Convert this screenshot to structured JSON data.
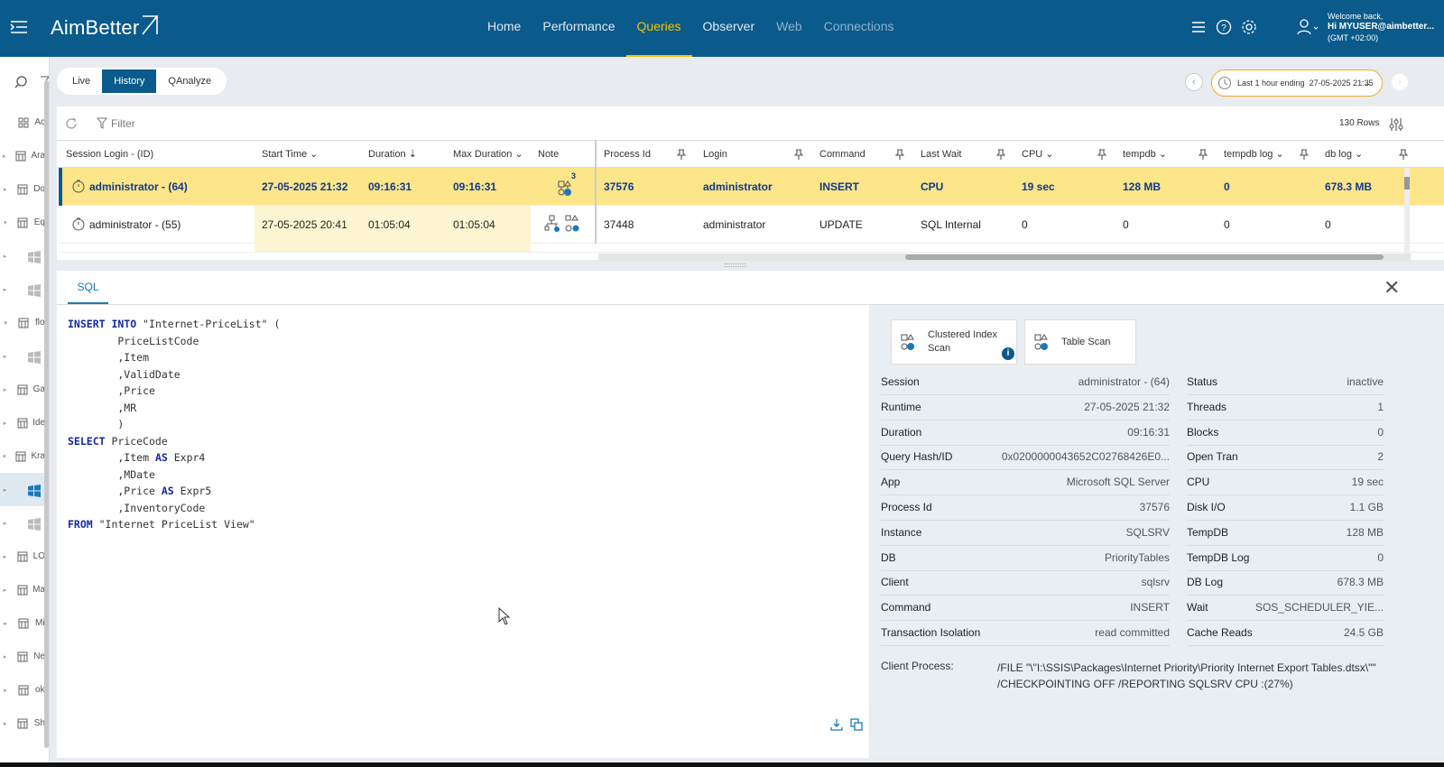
{
  "header": {
    "logo": "AimBetter",
    "nav": [
      {
        "label": "Home",
        "state": "normal"
      },
      {
        "label": "Performance",
        "state": "normal"
      },
      {
        "label": "Queries",
        "state": "active"
      },
      {
        "label": "Observer",
        "state": "normal"
      },
      {
        "label": "Web",
        "state": "dim"
      },
      {
        "label": "Connections",
        "state": "dim"
      }
    ],
    "welcome": "Welcome back,",
    "user": "Hi MYUSER@aimbetter...",
    "tz": "(GMT +02:00)",
    "icons": [
      "list-icon",
      "help-icon",
      "gear-icon",
      "user-icon"
    ]
  },
  "sidebar": {
    "rows": [
      {
        "label": "Ac",
        "icon": "grid-icon",
        "tri": ""
      },
      {
        "label": "Ara",
        "icon": "table-icon",
        "tri": "▸"
      },
      {
        "label": "Do",
        "icon": "table-icon",
        "tri": "▸"
      },
      {
        "label": "Eq",
        "icon": "table-icon",
        "tri": "▾"
      },
      {
        "label": "",
        "icon": "windows-icon",
        "tri": "▸"
      },
      {
        "label": "",
        "icon": "windows-icon",
        "tri": "▸"
      },
      {
        "label": "flo",
        "icon": "table-icon",
        "tri": "▾"
      },
      {
        "label": "",
        "icon": "windows-icon",
        "tri": "▸"
      },
      {
        "label": "Ga",
        "icon": "table-icon",
        "tri": "▸"
      },
      {
        "label": "Ide",
        "icon": "table-icon",
        "tri": "▸"
      },
      {
        "label": "Kra",
        "icon": "table-icon",
        "tri": "▾"
      },
      {
        "label": "",
        "icon": "windows-icon",
        "tri": "▸",
        "selected": true
      },
      {
        "label": "",
        "icon": "windows-icon",
        "tri": "▸"
      },
      {
        "label": "LO",
        "icon": "table-icon",
        "tri": "▸"
      },
      {
        "label": "Ma",
        "icon": "table-icon",
        "tri": "▸"
      },
      {
        "label": "Mi",
        "icon": "table-icon",
        "tri": "▸"
      },
      {
        "label": "Ne",
        "icon": "table-icon",
        "tri": "▸"
      },
      {
        "label": "ok",
        "icon": "table-icon",
        "tri": "▸"
      },
      {
        "label": "Sh",
        "icon": "table-icon",
        "tri": "▸"
      }
    ]
  },
  "toolbar": {
    "tabs": [
      {
        "label": "Live"
      },
      {
        "label": "History",
        "active": true
      },
      {
        "label": "QAnalyze"
      }
    ],
    "time_prefix": "Last 1 hour ending",
    "time_value": "27-05-2025 21:35"
  },
  "grid": {
    "filter_placeholder": "Filter",
    "rows_count": "130 Rows",
    "columns": [
      "Session Login - (ID)",
      "Start Time",
      "Duration",
      "Max Duration",
      "Note",
      "Process Id",
      "Login",
      "Command",
      "Last Wait",
      "CPU",
      "tempdb",
      "tempdb log",
      "db log"
    ],
    "rows": [
      {
        "session": "administrator - (64)",
        "start": "27-05-2025 21:32",
        "duration": "09:16:31",
        "max_duration": "09:16:31",
        "note_badge": "3",
        "process_id": "37576",
        "login": "administrator",
        "command": "INSERT",
        "last_wait": "CPU",
        "cpu": "19 sec",
        "tempdb": "128 MB",
        "tempdb_log": "0",
        "db_log": "678.3 MB"
      },
      {
        "session": "administrator - (55)",
        "start": "27-05-2025 20:41",
        "duration": "01:05:04",
        "max_duration": "01:05:04",
        "note_badge": "",
        "process_id": "37448",
        "login": "administrator",
        "command": "UPDATE",
        "last_wait": "SQL Internal",
        "cpu": "0",
        "tempdb": "0",
        "tempdb_log": "0",
        "db_log": "0"
      }
    ]
  },
  "detail": {
    "tab": "SQL",
    "sql_lines": [
      [
        [
          "kw",
          "INSERT INTO"
        ],
        [
          "t",
          " \"Internet-PriceList\" ("
        ]
      ],
      [
        [
          "t",
          "        PriceListCode"
        ]
      ],
      [
        [
          "t",
          "        ,Item"
        ]
      ],
      [
        [
          "t",
          "        ,ValidDate"
        ]
      ],
      [
        [
          "t",
          "        ,Price"
        ]
      ],
      [
        [
          "t",
          "        ,MR"
        ]
      ],
      [
        [
          "t",
          "        )"
        ]
      ],
      [
        [
          "kw",
          "SELECT"
        ],
        [
          "t",
          " PriceCode"
        ]
      ],
      [
        [
          "t",
          "        ,Item "
        ],
        [
          "kw",
          "AS"
        ],
        [
          "t",
          " Expr4"
        ]
      ],
      [
        [
          "t",
          "        ,MDate"
        ]
      ],
      [
        [
          "t",
          "        ,Price "
        ],
        [
          "kw",
          "AS"
        ],
        [
          "t",
          " Expr5"
        ]
      ],
      [
        [
          "t",
          "        ,InventoryCode"
        ]
      ],
      [
        [
          "kw",
          "FROM"
        ],
        [
          "t",
          " \"Internet PriceList View\""
        ]
      ]
    ],
    "plan_buttons": [
      {
        "label_line1": "Clustered Index",
        "label_line2": "Scan"
      },
      {
        "label_line1": "Table Scan",
        "label_line2": ""
      }
    ],
    "left_info": [
      {
        "k": "Session",
        "v": "administrator - (64)"
      },
      {
        "k": "Runtime",
        "v": "27-05-2025 21:32"
      },
      {
        "k": "Duration",
        "v": "09:16:31"
      },
      {
        "k": "Query Hash/ID",
        "v": "0x0200000043652C02768426E0..."
      },
      {
        "k": "App",
        "v": "Microsoft SQL Server"
      },
      {
        "k": "Process Id",
        "v": "37576"
      },
      {
        "k": "Instance",
        "v": "SQLSRV"
      },
      {
        "k": "DB",
        "v": "PriorityTables"
      },
      {
        "k": "Client",
        "v": "sqlsrv"
      },
      {
        "k": "Command",
        "v": "INSERT"
      },
      {
        "k": "Transaction Isolation",
        "v": "read committed"
      }
    ],
    "right_info": [
      {
        "k": "Status",
        "v": "inactive"
      },
      {
        "k": "Threads",
        "v": "1"
      },
      {
        "k": "Blocks",
        "v": "0"
      },
      {
        "k": "Open Tran",
        "v": "2"
      },
      {
        "k": "CPU",
        "v": "19 sec"
      },
      {
        "k": "Disk I/O",
        "v": "1.1 GB"
      },
      {
        "k": "TempDB",
        "v": "128 MB"
      },
      {
        "k": "TempDB Log",
        "v": "0"
      },
      {
        "k": "DB Log",
        "v": "678.3 MB"
      },
      {
        "k": "Wait",
        "v": "SOS_SCHEDULER_YIE..."
      },
      {
        "k": "Cache Reads",
        "v": "24.5 GB"
      }
    ],
    "client_process_label": "Client Process:",
    "client_process_value": "/FILE \"\\\"I:\\SSIS\\Packages\\Internet Priority\\Priority Internet Export Tables.dtsx\\\"\" /CHECKPOINTING OFF /REPORTING SQLSRV CPU :(27%)"
  },
  "colors": {
    "brand": "#0a5a8c",
    "accent": "#f5c400",
    "row_highlight": "#fde589",
    "link": "#1a7ab8"
  }
}
